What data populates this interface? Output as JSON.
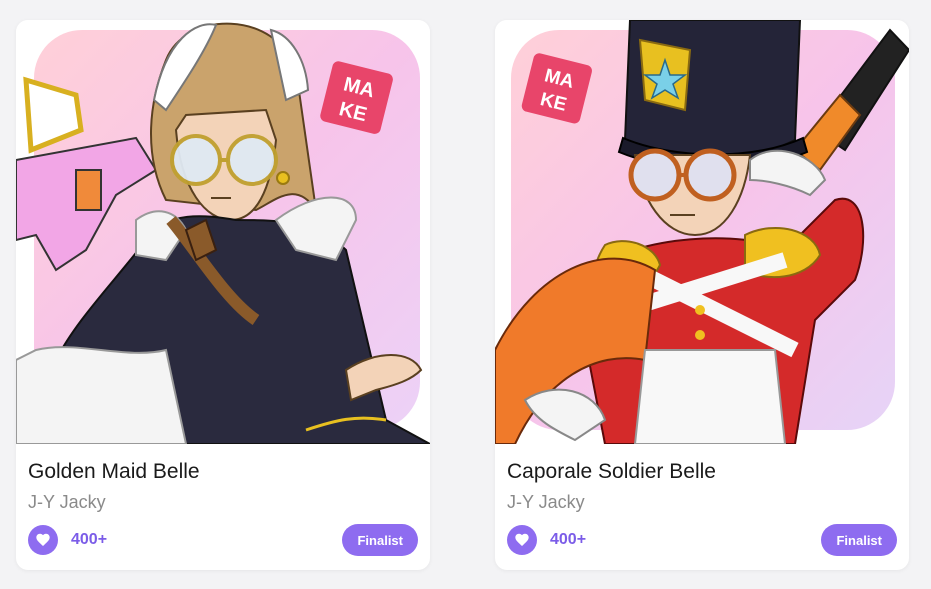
{
  "colors": {
    "accent": "#8e6cf0",
    "accent_text": "#7b5ce8",
    "background_pink": "#f7c9e6",
    "make_logo": "#e8456a"
  },
  "cards": [
    {
      "title": "Golden Maid Belle",
      "author": "J-Y Jacky",
      "likes": "400+",
      "badge": "Finalist",
      "art_logo": "MAKE",
      "like_icon": "heart-icon"
    },
    {
      "title": "Caporale Soldier Belle",
      "author": "J-Y Jacky",
      "likes": "400+",
      "badge": "Finalist",
      "art_logo": "MAKE",
      "like_icon": "heart-icon"
    }
  ]
}
